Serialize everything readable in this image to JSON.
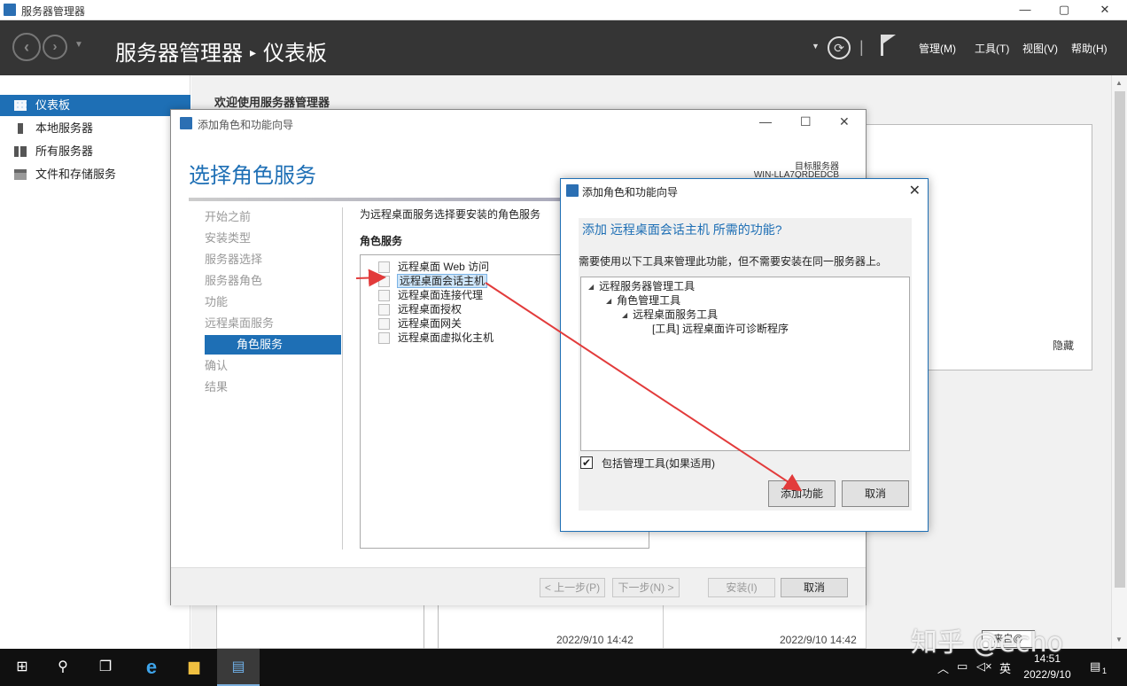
{
  "window": {
    "title": "服务器管理器",
    "min": "—",
    "max": "▢",
    "close": "✕"
  },
  "header": {
    "breadcrumb_app": "服务器管理器",
    "breadcrumb_sep": "▸",
    "breadcrumb_page": "仪表板",
    "menus": [
      "管理(M)",
      "工具(T)",
      "视图(V)",
      "帮助(H)"
    ]
  },
  "sidebar": {
    "items": [
      {
        "label": "仪表板",
        "icon": "dashboard-icon"
      },
      {
        "label": "本地服务器",
        "icon": "server-icon"
      },
      {
        "label": "所有服务器",
        "icon": "servers-icon"
      },
      {
        "label": "文件和存储服务",
        "icon": "storage-icon"
      }
    ]
  },
  "main": {
    "welcome": "欢迎使用服务器管理器",
    "hide_label": "隐藏",
    "tile_dates": [
      "2022/9/10 14:42",
      "2022/9/10 14:42"
    ]
  },
  "wizard": {
    "title": "添加角色和功能向导",
    "heading": "选择角色服务",
    "target_label": "目标服务器",
    "target_value": "WIN-LLA7QRDEDCB",
    "steps": [
      "开始之前",
      "安装类型",
      "服务器选择",
      "服务器角色",
      "功能",
      "远程桌面服务",
      "角色服务",
      "确认",
      "结果"
    ],
    "current_step_index": 6,
    "description": "为远程桌面服务选择要安装的角色服务",
    "role_services_label": "角色服务",
    "role_services": [
      "远程桌面 Web 访问",
      "远程桌面会话主机",
      "远程桌面连接代理",
      "远程桌面授权",
      "远程桌面网关",
      "远程桌面虚拟化主机"
    ],
    "selected_index": 1,
    "buttons": {
      "prev": "< 上一步(P)",
      "next": "下一步(N) >",
      "install": "安装(I)",
      "cancel": "取消"
    }
  },
  "dialog": {
    "title": "添加角色和功能向导",
    "heading": "添加 远程桌面会话主机 所需的功能?",
    "description": "需要使用以下工具来管理此功能，但不需要安装在同一服务器上。",
    "tree": [
      {
        "label": "远程服务器管理工具",
        "level": 0,
        "expanded": true
      },
      {
        "label": "角色管理工具",
        "level": 1,
        "expanded": true
      },
      {
        "label": "远程桌面服务工具",
        "level": 2,
        "expanded": true
      },
      {
        "label": "[工具] 远程桌面许可诊断程序",
        "level": 3,
        "expanded": false
      }
    ],
    "include_tools_label": "包括管理工具(如果适用)",
    "include_tools_checked": true,
    "add_button": "添加功能",
    "cancel_button": "取消"
  },
  "taskbar": {
    "time": "14:51",
    "date": "2022/9/10",
    "ime": "英",
    "notification_count": "1"
  },
  "watermark": {
    "text": "知乎 @echo",
    "box_text": "来自@"
  },
  "colors": {
    "accent": "#1e6fb5",
    "header_bg": "#353535",
    "annotation_red": "#e23b3b"
  }
}
